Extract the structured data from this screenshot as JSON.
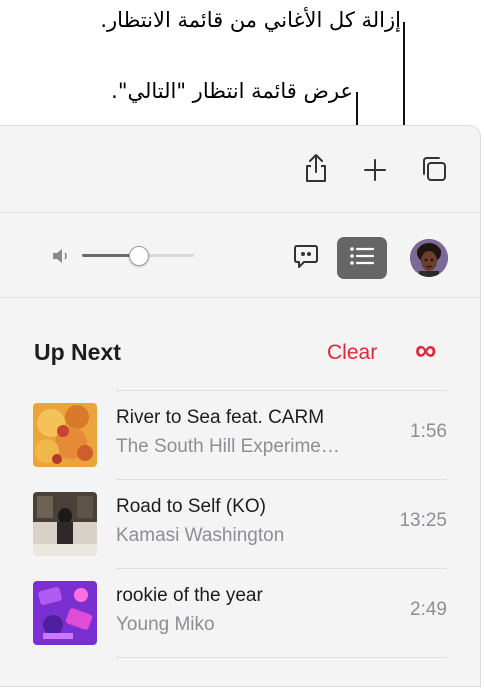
{
  "callouts": {
    "clear_all": "إزالة كل الأغاني من قائمة الانتظار.",
    "show_up_next": "عرض قائمة انتظار \"التالي\"."
  },
  "toolbar": {
    "icons": [
      "share-icon",
      "plus-icon",
      "duplicate-icon"
    ]
  },
  "controls": {
    "volume_level": 0.5,
    "icons": [
      "speaker-icon",
      "lyrics-icon",
      "queue-list-icon",
      "avatar"
    ]
  },
  "up_next": {
    "title": "Up Next",
    "clear_label": "Clear",
    "infinity_symbol": "∞",
    "accent_color": "#e0263f",
    "tracks": [
      {
        "title": "River to Sea feat. CARM",
        "artist": "The South Hill Experime…",
        "duration": "1:56"
      },
      {
        "title": "Road to Self (KO)",
        "artist": "Kamasi Washington",
        "duration": "13:25"
      },
      {
        "title": "rookie of the year",
        "artist": "Young Miko",
        "duration": "2:49"
      }
    ]
  }
}
